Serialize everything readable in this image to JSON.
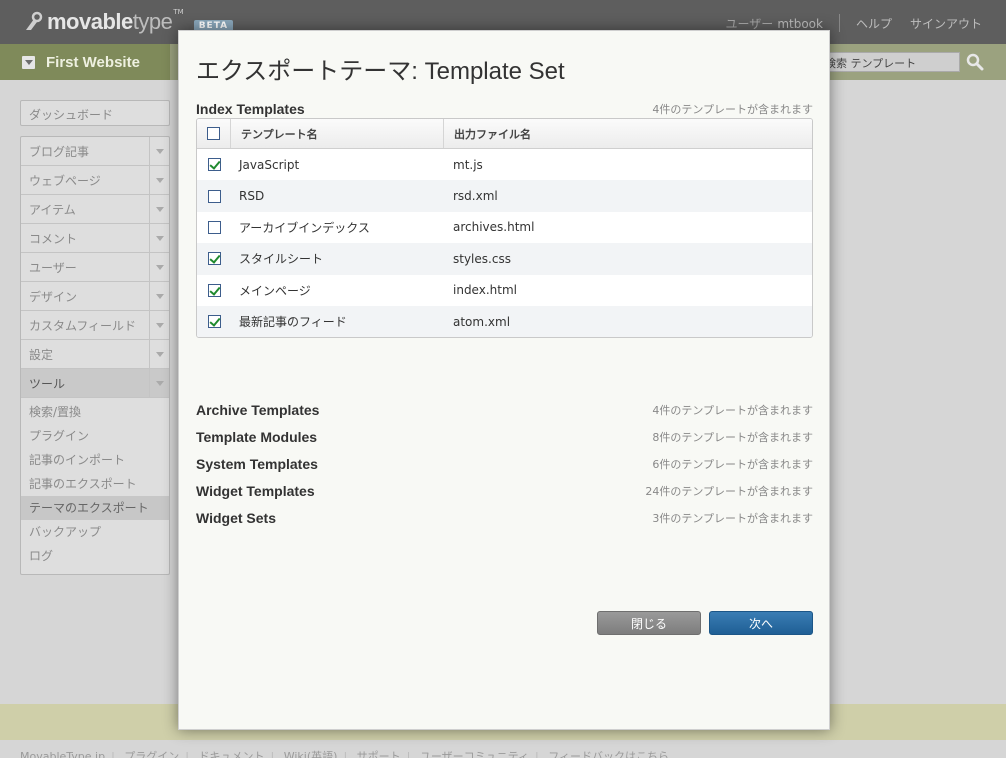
{
  "app": {
    "logo_bold": "movable",
    "logo_light": "type",
    "logo_tm": "TM",
    "beta": "BETA",
    "user_label": "ユーザー",
    "user_name": "mtbook",
    "help": "ヘルプ",
    "signout": "サインアウト"
  },
  "scope": {
    "name": "First Website",
    "search_value": "検索 テンプレート"
  },
  "sidebar": {
    "dashboard": "ダッシュボード",
    "items": [
      {
        "label": "ブログ記事"
      },
      {
        "label": "ウェブページ"
      },
      {
        "label": "アイテム"
      },
      {
        "label": "コメント"
      },
      {
        "label": "ユーザー"
      },
      {
        "label": "デザイン"
      },
      {
        "label": "カスタムフィールド"
      },
      {
        "label": "設定"
      },
      {
        "label": "ツール"
      }
    ],
    "tools_sub": [
      "検索/置換",
      "プラグイン",
      "記事のインポート",
      "記事のエクスポート",
      "テーマのエクスポート",
      "バックアップ",
      "ログ"
    ]
  },
  "footer": {
    "links": [
      "MovableType.jp",
      "プラグイン",
      "ドキュメント",
      "Wiki(英語)",
      "サポート",
      "ユーザーコミュニティ",
      "フィードバックはこちら"
    ]
  },
  "modal": {
    "title": "エクスポートテーマ: Template Set",
    "index": {
      "name": "Index Templates",
      "count": "4件のテンプレートが含まれます",
      "col_name": "テンプレート名",
      "col_file": "出力ファイル名",
      "rows": [
        {
          "name": "JavaScript",
          "file": "mt.js",
          "checked": true
        },
        {
          "name": "RSD",
          "file": "rsd.xml",
          "checked": false
        },
        {
          "name": "アーカイブインデックス",
          "file": "archives.html",
          "checked": false
        },
        {
          "name": "スタイルシート",
          "file": "styles.css",
          "checked": true
        },
        {
          "name": "メインページ",
          "file": "index.html",
          "checked": true
        },
        {
          "name": "最新記事のフィード",
          "file": "atom.xml",
          "checked": true
        }
      ]
    },
    "sections": [
      {
        "name": "Archive Templates",
        "count": "4件のテンプレートが含まれます"
      },
      {
        "name": "Template Modules",
        "count": "8件のテンプレートが含まれます"
      },
      {
        "name": "System Templates",
        "count": "6件のテンプレートが含まれます"
      },
      {
        "name": "Widget Templates",
        "count": "24件のテンプレートが含まれます"
      },
      {
        "name": "Widget Sets",
        "count": "3件のテンプレートが含まれます"
      }
    ],
    "close_label": "閉じる",
    "next_label": "次へ"
  },
  "colors": {
    "accent": "#1f5f95",
    "topbar": "#5e5e5e",
    "scopebar": "#9ba27f"
  }
}
